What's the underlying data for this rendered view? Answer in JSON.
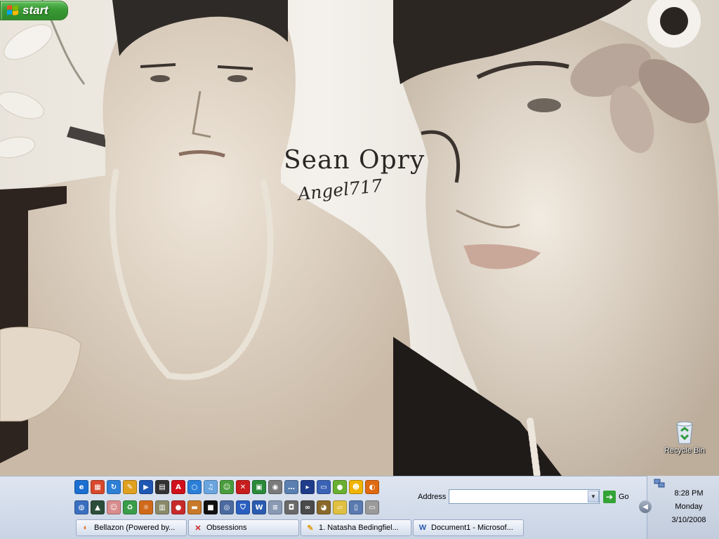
{
  "wallpaper": {
    "title": "Sean Opry",
    "signature": "Angel717"
  },
  "desktop_icons": [
    {
      "label": "Recycle Bin",
      "icon": "recycle-bin-icon"
    }
  ],
  "taskbar": {
    "start_label": "start",
    "quick_launch_row1": [
      {
        "icon": "internet-explorer-icon",
        "color": "#1c6fd1",
        "glyph": "e"
      },
      {
        "icon": "paint-icon",
        "color": "#d8482c",
        "glyph": "▦"
      },
      {
        "icon": "ie-refresh-icon",
        "color": "#2e7fd6",
        "glyph": "↻"
      },
      {
        "icon": "pencil-icon",
        "color": "#e0a020",
        "glyph": "✎"
      },
      {
        "icon": "media-player-icon",
        "color": "#1f57b3",
        "glyph": "▶"
      },
      {
        "icon": "movie-maker-icon",
        "color": "#333333",
        "glyph": "▤"
      },
      {
        "icon": "ati-icon",
        "color": "#d0101a",
        "glyph": "A"
      },
      {
        "icon": "search-icon",
        "color": "#2a7fd8",
        "glyph": "○"
      },
      {
        "icon": "itunes-icon",
        "color": "#6aa5e0",
        "glyph": "♫"
      },
      {
        "icon": "messenger-icon",
        "color": "#4a9d3c",
        "glyph": "☺"
      },
      {
        "icon": "antivirus-icon",
        "color": "#c81e1e",
        "glyph": "✕"
      },
      {
        "icon": "film-icon",
        "color": "#2b8a3a",
        "glyph": "▣"
      },
      {
        "icon": "mouse-icon",
        "color": "#7a7a7a",
        "glyph": "◉"
      },
      {
        "icon": "chat-bubble-icon",
        "color": "#5a7fb0",
        "glyph": "…"
      },
      {
        "icon": "command-prompt-icon",
        "color": "#1f3c8a",
        "glyph": "▸"
      },
      {
        "icon": "window-icon",
        "color": "#3a62b5",
        "glyph": "▭"
      },
      {
        "icon": "green-app-icon",
        "color": "#6ab030",
        "glyph": "●"
      },
      {
        "icon": "yahoo-messenger-icon",
        "color": "#f0b400",
        "glyph": "☻"
      },
      {
        "icon": "firefox-icon",
        "color": "#e06a10",
        "glyph": "◐"
      }
    ],
    "quick_launch_row2": [
      {
        "icon": "globe-icon",
        "color": "#3a6fc0",
        "glyph": "◍"
      },
      {
        "icon": "picture-icon",
        "color": "#2c4d3a",
        "glyph": "▲"
      },
      {
        "icon": "portrait-icon",
        "color": "#d98c8c",
        "glyph": "☺"
      },
      {
        "icon": "recycle-icon",
        "color": "#3a9d4a",
        "glyph": "♻"
      },
      {
        "icon": "tiger-icon",
        "color": "#d06a1a",
        "glyph": "☼"
      },
      {
        "icon": "chart-icon",
        "color": "#8a8a6a",
        "glyph": "▥"
      },
      {
        "icon": "stop-sign-icon",
        "color": "#c82a2a",
        "glyph": "●"
      },
      {
        "icon": "photo-icon",
        "color": "#c87a2a",
        "glyph": "▬"
      },
      {
        "icon": "black-box-icon",
        "color": "#111111",
        "glyph": "■"
      },
      {
        "icon": "disc-icon",
        "color": "#4a6aa0",
        "glyph": "◎"
      },
      {
        "icon": "shield-icon",
        "color": "#2a5fc0",
        "glyph": "⛉"
      },
      {
        "icon": "word-icon",
        "color": "#2a5bb0",
        "glyph": "W"
      },
      {
        "icon": "notepad-icon",
        "color": "#8a9ab5",
        "glyph": "≡"
      },
      {
        "icon": "camera-icon",
        "color": "#6a6a6a",
        "glyph": "◘"
      },
      {
        "icon": "binoculars-icon",
        "color": "#4a4a4a",
        "glyph": "∞"
      },
      {
        "icon": "owl-icon",
        "color": "#8a6a2a",
        "glyph": "◕"
      },
      {
        "icon": "folder-icon",
        "color": "#e0c040",
        "glyph": "▱"
      },
      {
        "icon": "computer-icon",
        "color": "#5a7ab0",
        "glyph": "▯"
      },
      {
        "icon": "drive-icon",
        "color": "#9a9a9a",
        "glyph": "▭"
      }
    ],
    "address_label": "Address",
    "address_value": "",
    "go_label": "Go",
    "tasks": [
      {
        "label": "Bellazon (Powered by...",
        "icon": "firefox-icon",
        "color": "#e06a10"
      },
      {
        "label": "Obsessions",
        "icon": "close-x-icon",
        "color": "#c81e1e"
      },
      {
        "label": "1. Natasha Bedingfiel...",
        "icon": "pencil-icon",
        "color": "#e0a020"
      },
      {
        "label": "Document1 - Microsof...",
        "icon": "word-icon",
        "color": "#2a5bb0"
      }
    ]
  },
  "clock": {
    "time": "8:28 PM",
    "day": "Monday",
    "date": "3/10/2008"
  }
}
